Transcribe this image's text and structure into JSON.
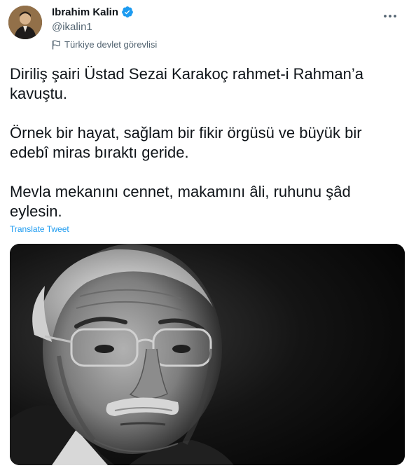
{
  "author": {
    "display_name": "Ibrahim Kalin",
    "handle": "@ikalin1",
    "label": "Türkiye devlet görevlisi",
    "avatar_icon": "profile-photo",
    "verified_icon": "verified-badge-icon",
    "verified_color": "#1d9bf0"
  },
  "tweet": {
    "paragraphs": [
      "Diriliş şairi Üstad Sezai Karakoç rahmet-i Rahman’a kavuştu.",
      "Örnek bir hayat, sağlam bir fikir örgüsü ve büyük bir edebî miras bıraktı geride.",
      "Mevla mekanını cennet, makamını âli, ruhunu şâd eylesin."
    ],
    "translate_label": "Translate Tweet"
  },
  "colors": {
    "text": "#0f1419",
    "secondary": "#536471",
    "link": "#1d9bf0"
  }
}
